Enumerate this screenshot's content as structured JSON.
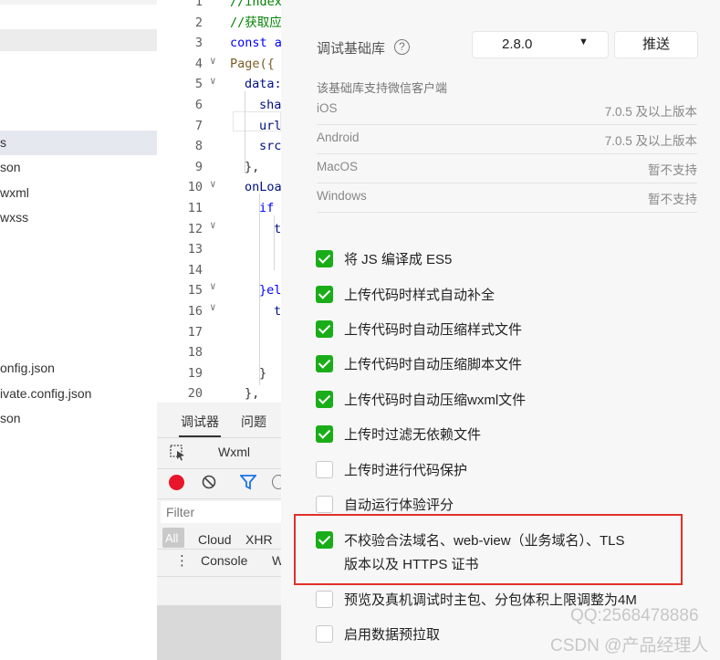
{
  "file_tree": {
    "items": [
      {
        "label": "s",
        "selected": true
      },
      {
        "label": "son"
      },
      {
        "label": "wxml"
      },
      {
        "label": "wxss"
      },
      {
        "label": "onfig.json"
      },
      {
        "label": "ivate.config.json"
      },
      {
        "label": "son"
      }
    ]
  },
  "editor": {
    "line_numbers": [
      "1",
      "2",
      "3",
      "4",
      "5",
      "6",
      "7",
      "8",
      "9",
      "10",
      "11",
      "12",
      "13",
      "14",
      "15",
      "16",
      "17",
      "18",
      "19",
      "20"
    ],
    "code": [
      {
        "text": "//index",
        "cls": "cm"
      },
      {
        "text": "//获取应",
        "cls": "cm"
      },
      {
        "text": "const a",
        "cls": "kw"
      },
      {
        "text": "Page({",
        "cls": "fn"
      },
      {
        "text": "data:",
        "cls": "pr"
      },
      {
        "text": "sha",
        "cls": "pr"
      },
      {
        "text": "url",
        "cls": "pr"
      },
      {
        "text": "src",
        "cls": "pr"
      },
      {
        "text": "},",
        "cls": ""
      },
      {
        "text": "onLoa",
        "cls": "pr"
      },
      {
        "text": "if",
        "cls": "kw"
      },
      {
        "text": "t",
        "cls": "pr"
      },
      {
        "text": "",
        "cls": ""
      },
      {
        "text": "",
        "cls": ""
      },
      {
        "text": "}el",
        "cls": "kw"
      },
      {
        "text": "t",
        "cls": "pr"
      },
      {
        "text": "",
        "cls": ""
      },
      {
        "text": "",
        "cls": ""
      },
      {
        "text": "}",
        "cls": ""
      },
      {
        "text": "},",
        "cls": ""
      }
    ]
  },
  "devtools": {
    "tabs": {
      "debugger": "调试器",
      "issues": "问题"
    },
    "wxml_tab": "Wxml",
    "filter_placeholder": "Filter",
    "net_filters": {
      "all": "All",
      "cloud": "Cloud",
      "xhr": "XHR"
    },
    "console_tab": "Console",
    "console_more": "W"
  },
  "settings": {
    "base_lib_label": "调试基础库",
    "base_lib_version": "2.8.0",
    "push_button": "推送",
    "support_title": "该基础库支持微信客户端",
    "support_rows": [
      {
        "platform": "iOS",
        "status": "7.0.5 及以上版本"
      },
      {
        "platform": "Android",
        "status": "7.0.5 及以上版本"
      },
      {
        "platform": "MacOS",
        "status": "暂不支持"
      },
      {
        "platform": "Windows",
        "status": "暂不支持"
      }
    ],
    "options": [
      {
        "label": "将 JS 编译成 ES5",
        "checked": true
      },
      {
        "label": "上传代码时样式自动补全",
        "checked": true
      },
      {
        "label": "上传代码时自动压缩样式文件",
        "checked": true
      },
      {
        "label": "上传代码时自动压缩脚本文件",
        "checked": true
      },
      {
        "label": "上传代码时自动压缩wxml文件",
        "checked": true
      },
      {
        "label": "上传时过滤无依赖文件",
        "checked": true
      },
      {
        "label": "上传时进行代码保护",
        "checked": false
      },
      {
        "label": "自动运行体验评分",
        "checked": false
      },
      {
        "label": "不校验合法域名、web-view（业务域名）、TLS",
        "label_line2": "版本以及 HTTPS 证书",
        "checked": true
      },
      {
        "label": "预览及真机调试时主包、分包体积上限调整为4M",
        "checked": false
      },
      {
        "label": "启用数据预拉取",
        "checked": false
      }
    ]
  },
  "watermark": {
    "qq": "QQ:2568478886",
    "csdn": "CSDN @产品经理人"
  },
  "colors": {
    "checkbox": "#1aad19",
    "highlight_box": "#e0302a"
  }
}
